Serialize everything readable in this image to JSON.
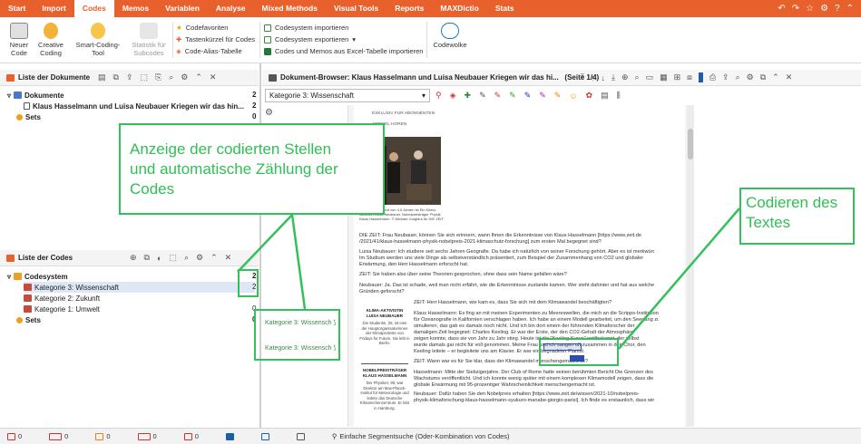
{
  "menu": [
    "Start",
    "Import",
    "Codes",
    "Memos",
    "Variablen",
    "Analyse",
    "Mixed Methods",
    "Visual Tools",
    "Reports",
    "MAXDictio",
    "Stats"
  ],
  "menu_active": "Codes",
  "ribbon": {
    "neuer_code": "Neuer\nCode",
    "creative_coding": "Creative\nCoding",
    "smart_coding": "Smart-Coding-\nTool",
    "statistik": "Statistik für\nSubcodes",
    "codefavoriten": "Codefavoriten",
    "tastenkuerzel": "Tastenkürzel für Codes",
    "code_alias": "Code-Alias-Tabelle",
    "codesystem_importieren": "Codesystem importieren",
    "codesystem_exportieren": "Codesystem exportieren",
    "codes_memos_excel": "Codes und Memos aus Excel-Tabelle importieren",
    "codewolke": "Codewolke"
  },
  "documents_panel": {
    "title": "Liste der Dokumente",
    "root": "Dokumente",
    "root_count": "2",
    "doc": "Klaus Hasselmann und Luisa Neubauer Kriegen wir das hin...",
    "doc_count": "2",
    "sets": "Sets",
    "sets_count": "0"
  },
  "codes_panel": {
    "title": "Liste der Codes",
    "root": "Codesystem",
    "root_count": "2",
    "items": [
      {
        "label": "Kategorie 3: Wissenschaft",
        "count": "2"
      },
      {
        "label": "Kategorie 2: Zukunft",
        "count": ""
      },
      {
        "label": "Kategorie 1: Umwelt",
        "count": "0"
      }
    ],
    "sets": "Sets",
    "sets_count": "0"
  },
  "browser": {
    "title": "Dokument-Browser: Klaus Hasselmann und Luisa Neubauer Kriegen wir das hi...   (Seite 1/4)",
    "code_select": "Kategorie 3: Wissenschaft",
    "coding_chip": "Kategorie 3: Wissensch"
  },
  "document": {
    "kicker": "EXKLUSIV FÜR ABONNENTEN",
    "sub": "ARTIKEL HÖREN",
    "caption": "Ein Studenten und von 4,5 Jahren ist Ein Klima-Aktivistin Luisa Neubauer. Nobelpreisträger Physik Klaus Hasselmann. © Michael Jungblut für DIE ZEIT",
    "paragraphs": [
      "DIE ZEIT: Frau Neubauer, können Sie sich erinnern, wann Ihnen die Erkenntnisse von Klaus Hasselmann [https://www.zeit.de",
      "/2021/41/klaus-hasselmann-physik-nobelpreis-2021-klimaschutz-forschung] zum ersten Mal begegnet sind?",
      "Luisa Neubauer: Ich studiere seit sechs Jahren Geografie. Da habe ich natürlich von seiner Forschung gehört. Aber es ist merkwürdig:",
      "Im Studium werden uns viele Dinge als selbstverständlich präsentiert, zum Beispiel der Zusammenhang von CO2 und globaler",
      "Erwärmung, den Herr Hasselmann erforscht hat.",
      "ZEIT: Sie haben also über seine Theorien gesprochen, ohne dass sein Name gefallen wäre?",
      "Neubauer: Ja. Das ist schade, weil man nicht erfährt, wie die Erkenntnisse zustande kamen. Wer steht dahinter und hat aus welchen",
      "Gründen geforscht?",
      "ZEIT: Herr Hasselmann, wie kam es, dass Sie sich mit dem Klimawandel beschäftigten?",
      "Klaus Hasselmann: Es fing an mit meinen Experimenten zu Meereswellen, die mich an die Scripps-Institution",
      "für Ozeanografie in Kalifornien verschlagen haben. Ich habe an einem Modell gearbeitet, um den Seegang zu",
      "simulieren, das gab es damals noch nicht. Und ich bin dort einem der führenden Klimaforscher der",
      "damaligen Zeit begegnet: Charles Keeling. Er war der Erste, der den CO2-Gehalt der Atmosphäre",
      "zeigen konnte, dass sie von Jahr zu Jahr stieg. Heute ist die \"Keeling-Kurve\" weltbekannt, der selbst",
      "wurde damals gar nicht für voll genommen. Meine Frau und ich sangen oft zusammen in den Chor, den",
      "Keeling leitete – er begleitete uns am Klavier. Er war ein begnadeter Pianist.",
      "ZEIT: Wann war es für Sie klar, dass der Klimawandel menschengemacht ist?",
      "Hasselmann: Mitte der Siebzigerjahre. Der Club of Rome hatte seinen berühmten Bericht Die Grenzen des",
      "Wachstums veröffentlicht. Und ich konnte wenig später mit einem komplexen Klimamodell zeigen, dass die",
      "globale Erwärmung mit 95-prozentiger Wahrscheinlichkeit menschengemacht ist.",
      "Neubauer: Dafür haben Sie den Nobelpreis erhalten [https://www.zeit.de/wissen/2021-10/nobelpreis-",
      "physik-klimaforschung-klaus-hasselmann-syukuro-manabe-giorgio-parisi]. Ich finde es erstaunlich, dass wir"
    ],
    "sidebar1_title": "KLIMA-AKTIVISTIN\nLUISA NEUBAUER",
    "sidebar1_text": "Die Studentin, 25, ist eine der Hauptorganisatorinnen der Klimaproteste von Fridays for Future. Sie lebt in Berlin.",
    "sidebar2_title": "NOBELPREISTRÄGER\nKLAUS HASSELMANN",
    "sidebar2_text": "Der Physiker, 90, war Direktor am Max-Planck-Institut für Meteorologie und leitete das Deutsche Klimarechenzentrum. Er lebt in Hamburg."
  },
  "annotations": {
    "left": "Anzeige der codierten Stellen\nund automatische Zählung der\nCodes",
    "right": "Codieren des\nTextes"
  },
  "status": {
    "s1": "0",
    "s2": "0",
    "s3": "0",
    "s4": "0",
    "s5": "0",
    "search": "Einfache Segmentsuche (Oder-Kombination von Codes)"
  },
  "colors": {
    "accent": "#e8612c",
    "annotation": "#34c05a",
    "highlight": "#2a4fb0"
  }
}
